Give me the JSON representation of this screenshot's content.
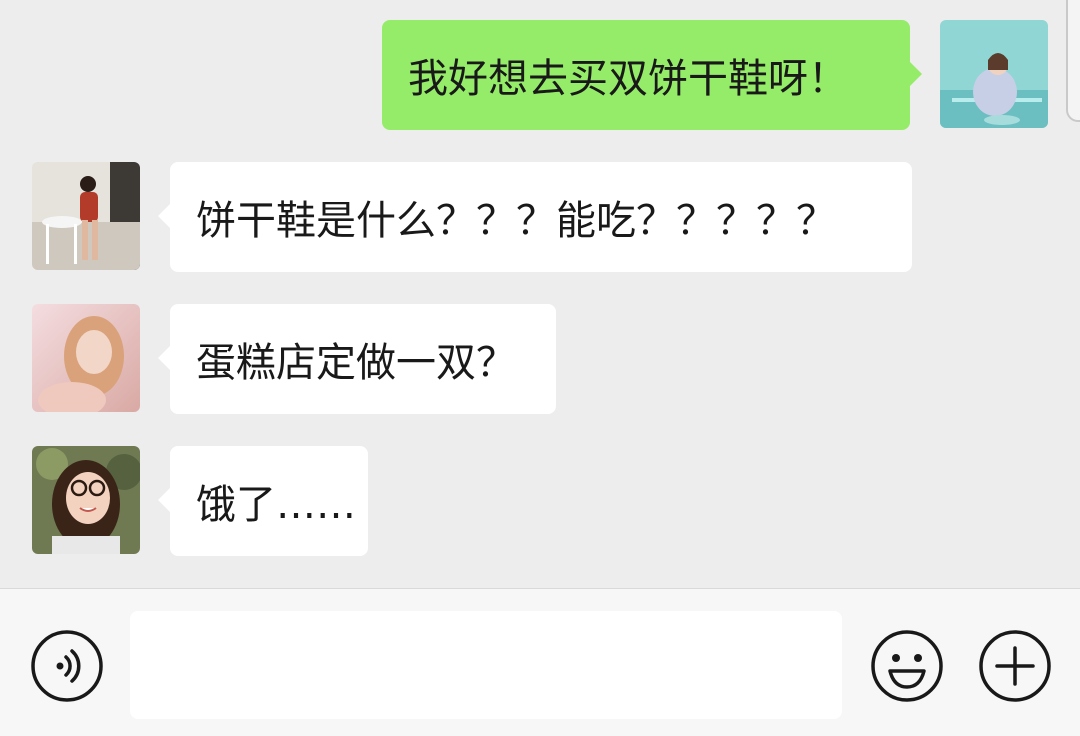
{
  "messages": [
    {
      "direction": "out",
      "sender": "self",
      "text": "我好想去买双饼干鞋呀！"
    },
    {
      "direction": "in",
      "sender": "friend1",
      "text": "饼干鞋是什么？？？能吃？？？？？"
    },
    {
      "direction": "in",
      "sender": "friend2",
      "text": "蛋糕店定做一双？"
    },
    {
      "direction": "in",
      "sender": "friend3",
      "text": "饿了……"
    }
  ],
  "input_bar": {
    "message_input": {
      "value": "",
      "placeholder": ""
    },
    "icons": {
      "voice": "voice-icon",
      "emoji": "emoji-icon",
      "more": "plus-icon"
    }
  },
  "colors": {
    "background": "#ededed",
    "bubble_out": "#95ec69",
    "bubble_in": "#ffffff",
    "input_bar": "#f7f7f7"
  }
}
